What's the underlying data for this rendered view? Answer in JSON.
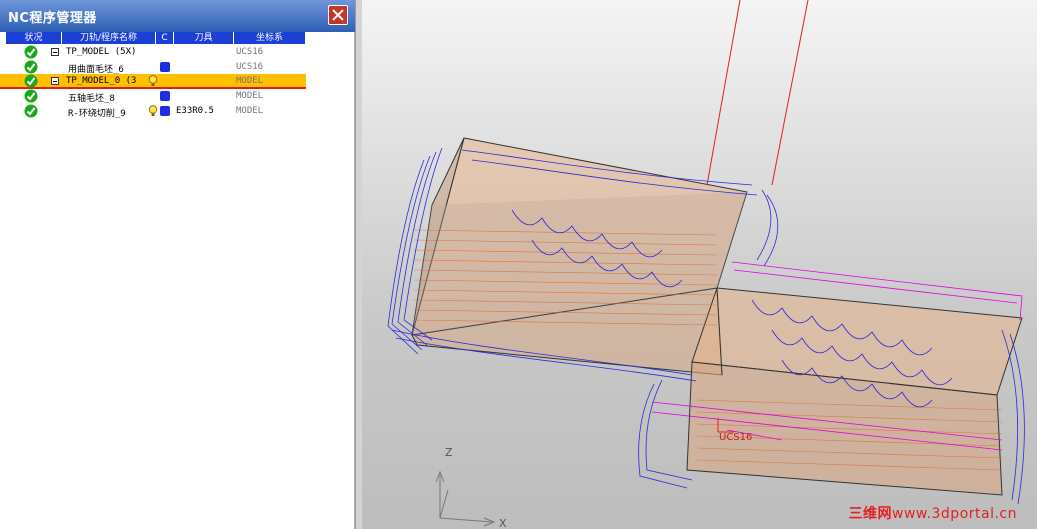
{
  "window": {
    "title": "NC程序管理器"
  },
  "columns": [
    "状况",
    "刀轨/程序名称",
    "C",
    "刀具",
    "坐标系"
  ],
  "rows": [
    {
      "name": "TP_MODEL (5X)",
      "tool": "",
      "coord": "UCS16",
      "expander": true,
      "blue": false,
      "bulb": false,
      "selected": false
    },
    {
      "name": "用曲面毛坯_6",
      "tool": "",
      "coord": "UCS16",
      "expander": false,
      "blue": true,
      "bulb": false,
      "selected": false
    },
    {
      "name": "TP_MODEL_0 (3",
      "tool": "",
      "coord": "MODEL",
      "expander": true,
      "blue": false,
      "bulb": true,
      "selected": true
    },
    {
      "name": "五轴毛坯_8",
      "tool": "",
      "coord": "MODEL",
      "expander": false,
      "blue": true,
      "bulb": false,
      "selected": false
    },
    {
      "name": "R-环绕切削_9",
      "tool": "E33R0.5",
      "coord": "MODEL",
      "expander": false,
      "blue": true,
      "bulb": true,
      "selected": false
    }
  ],
  "viewport": {
    "axis_z": "Z",
    "axis_x": "X",
    "ucs_label": "UCS16",
    "watermark_cn": "三维网",
    "watermark_en": "www.3dportal.cn"
  },
  "colors": {
    "accent": "#1c3fd6",
    "selected_row": "#ffc000",
    "toolpath_blue": "#2a2ad8",
    "toolpath_magenta": "#e000e0",
    "stock_orange": "#e8b48c",
    "tool_red": "#e02020",
    "check_green": "#18a818"
  }
}
